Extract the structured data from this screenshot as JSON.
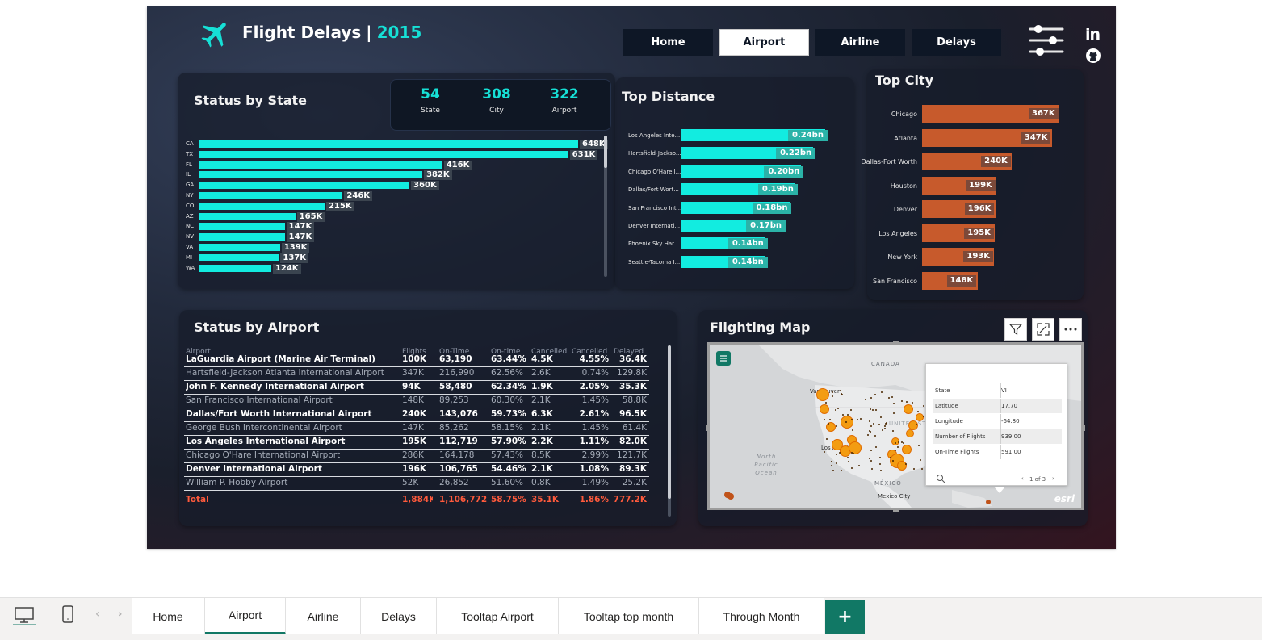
{
  "header": {
    "title": "Flight Delays",
    "separator": "|",
    "year": "2015",
    "nav": [
      "Home",
      "Airport",
      "Airline",
      "Delays"
    ],
    "active_nav": "Airport",
    "social": {
      "linkedin": "in"
    }
  },
  "status_by_state": {
    "title": "Status by State",
    "kpis": [
      {
        "value": "54",
        "label": "State"
      },
      {
        "value": "308",
        "label": "City"
      },
      {
        "value": "322",
        "label": "Airport"
      }
    ]
  },
  "top_distance": {
    "title": "Top Distance"
  },
  "top_city": {
    "title": "Top City"
  },
  "status_by_airport": {
    "title": "Status by Airport",
    "columns": [
      "Airport",
      "Flights",
      "On-Time",
      "On-time",
      "Cancelled",
      "Cancelled",
      "Delayed"
    ],
    "rows": [
      [
        "LaGuardia Airport (Marine Air Terminal)",
        "100K",
        "63,190",
        "63.44%",
        "4.5K",
        "4.55%",
        "36.4K"
      ],
      [
        "Hartsfield-Jackson Atlanta International Airport",
        "347K",
        "216,990",
        "62.56%",
        "2.6K",
        "0.74%",
        "129.8K"
      ],
      [
        "John F. Kennedy International Airport",
        "94K",
        "58,480",
        "62.34%",
        "1.9K",
        "2.05%",
        "35.3K"
      ],
      [
        "San Francisco International Airport",
        "148K",
        "89,253",
        "60.30%",
        "2.1K",
        "1.45%",
        "58.8K"
      ],
      [
        "Dallas/Fort Worth International Airport",
        "240K",
        "143,076",
        "59.73%",
        "6.3K",
        "2.61%",
        "96.5K"
      ],
      [
        "George Bush Intercontinental Airport",
        "147K",
        "85,262",
        "58.15%",
        "2.1K",
        "1.45%",
        "61.4K"
      ],
      [
        "Los Angeles International Airport",
        "195K",
        "112,719",
        "57.90%",
        "2.2K",
        "1.11%",
        "82.0K"
      ],
      [
        "Chicago O'Hare International Airport",
        "286K",
        "164,178",
        "57.43%",
        "8.5K",
        "2.99%",
        "121.7K"
      ],
      [
        "Denver International Airport",
        "196K",
        "106,765",
        "54.46%",
        "2.1K",
        "1.08%",
        "89.3K"
      ],
      [
        "William P. Hobby Airport",
        "52K",
        "26,852",
        "51.60%",
        "0.8K",
        "1.49%",
        "25.2K"
      ]
    ],
    "total": [
      "Total",
      "1,884K",
      "1,106,772",
      "58.75%",
      "35.1K",
      "1.86%",
      "777.2K"
    ]
  },
  "map": {
    "title": "Flighting Map",
    "labels": {
      "canada": "CANADA",
      "vancouver": "Vancouver",
      "los_angeles": "Los Angeles",
      "mexico": "MÉXICO",
      "mexico_city": "Mexico City",
      "ocean": "North Pacific Ocean",
      "united_states": "UNITED STATES",
      "esri": "esri"
    },
    "tooltip": {
      "rows": [
        [
          "State",
          "VI"
        ],
        [
          "Latitude",
          "17.70"
        ],
        [
          "Longitude",
          "-64.80"
        ],
        [
          "Number of Flights",
          "939.00"
        ],
        [
          "On-Time Flights",
          "591.00"
        ]
      ],
      "pager": "1 of 3"
    }
  },
  "chart_data": [
    {
      "type": "bar",
      "orientation": "horizontal",
      "title": "Status by State",
      "categories": [
        "CA",
        "TX",
        "FL",
        "IL",
        "GA",
        "NY",
        "CO",
        "AZ",
        "NC",
        "NV",
        "VA",
        "MI",
        "WA"
      ],
      "values": [
        648,
        631,
        416,
        382,
        360,
        246,
        215,
        165,
        147,
        147,
        139,
        137,
        124
      ],
      "data_labels": [
        "648K",
        "631K",
        "416K",
        "382K",
        "360K",
        "246K",
        "215K",
        "165K",
        "147K",
        "147K",
        "139K",
        "137K",
        "124K"
      ],
      "unit": "K",
      "color": "#12ece0"
    },
    {
      "type": "bar",
      "orientation": "horizontal",
      "title": "Top Distance",
      "categories": [
        "Los Angeles Inte...",
        "Hartsfield-Jackso...",
        "Chicago O'Hare I...",
        "Dallas/Fort Wort...",
        "San Francisco Int...",
        "Denver Internati...",
        "Phoenix Sky Har...",
        "Seattle-Tacoma I..."
      ],
      "values": [
        0.24,
        0.22,
        0.2,
        0.19,
        0.18,
        0.17,
        0.14,
        0.14
      ],
      "data_labels": [
        "0.24bn",
        "0.22bn",
        "0.20bn",
        "0.19bn",
        "0.18bn",
        "0.17bn",
        "0.14bn",
        "0.14bn"
      ],
      "unit": "bn",
      "color": "#12ece0"
    },
    {
      "type": "bar",
      "orientation": "horizontal",
      "title": "Top City",
      "categories": [
        "Chicago",
        "Atlanta",
        "Dallas-Fort Worth",
        "Houston",
        "Denver",
        "Los Angeles",
        "New York",
        "San Francisco"
      ],
      "values": [
        367,
        347,
        240,
        199,
        196,
        195,
        193,
        148
      ],
      "data_labels": [
        "367K",
        "347K",
        "240K",
        "199K",
        "196K",
        "195K",
        "193K",
        "148K"
      ],
      "unit": "K",
      "color": "#c75a2c"
    }
  ],
  "bottom_tabs": {
    "tabs": [
      "Home",
      "Airport",
      "Airline",
      "Delays",
      "Tooltap Airport",
      "Tooltap top month",
      "Through Month"
    ],
    "active": "Airport",
    "add_label": "+"
  },
  "colors": {
    "accent_cyan": "#12ece0",
    "accent_orange": "#c75a2c",
    "total_red": "#ff5a3c",
    "tab_green": "#117865"
  }
}
